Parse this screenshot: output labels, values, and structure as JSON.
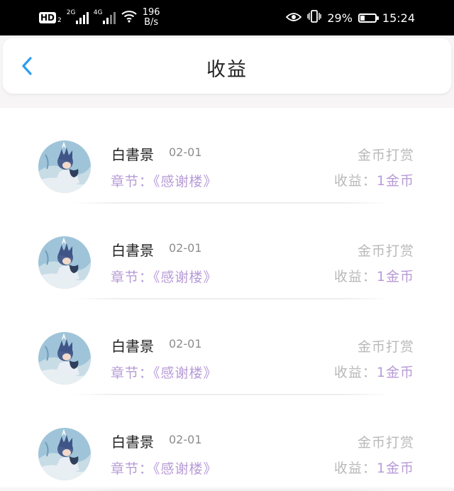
{
  "status_bar": {
    "hd_label": "HD",
    "hd_sub": "2",
    "net1": "2G",
    "net2": "4G",
    "speed_value": "196",
    "speed_unit": "B/s",
    "battery_percent": "29%",
    "battery_level": 0.29,
    "time": "15:24",
    "icons": [
      "eye-icon",
      "vibrate-icon",
      "battery-icon",
      "wifi-icon",
      "signal-icon"
    ]
  },
  "header": {
    "title": "收益",
    "back_icon": "chevron-left-icon",
    "accent_color": "#2d9cf0"
  },
  "colors": {
    "purple": "#b79bd6",
    "gray": "#b9b9b9",
    "dark": "#222222"
  },
  "items": [
    {
      "name": "白書景",
      "date": "02-01",
      "chapter_label": "章节：",
      "chapter_title": "《感谢楼》",
      "type": "金币打赏",
      "earning_label": "收益：",
      "earning_amount": "1金币"
    },
    {
      "name": "白書景",
      "date": "02-01",
      "chapter_label": "章节：",
      "chapter_title": "《感谢楼》",
      "type": "金币打赏",
      "earning_label": "收益：",
      "earning_amount": "1金币"
    },
    {
      "name": "白書景",
      "date": "02-01",
      "chapter_label": "章节：",
      "chapter_title": "《感谢楼》",
      "type": "金币打赏",
      "earning_label": "收益：",
      "earning_amount": "1金币"
    },
    {
      "name": "白書景",
      "date": "02-01",
      "chapter_label": "章节：",
      "chapter_title": "《感谢楼》",
      "type": "金币打赏",
      "earning_label": "收益：",
      "earning_amount": "1金币"
    }
  ]
}
